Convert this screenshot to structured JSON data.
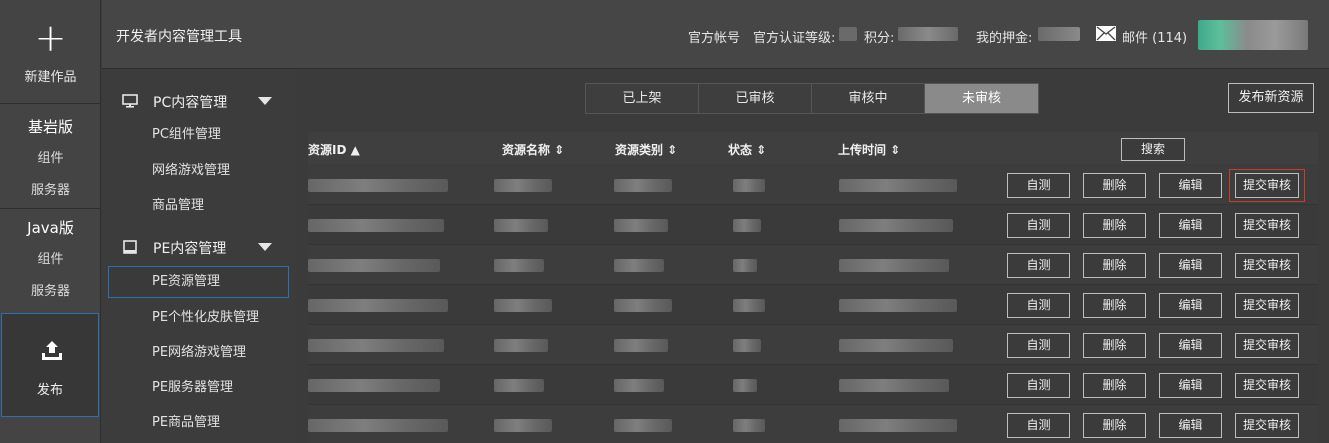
{
  "rail": {
    "new_label": "新建作品",
    "plus_icon": "plus-icon",
    "bedrock": {
      "title": "基岩版",
      "items": [
        "组件",
        "服务器"
      ]
    },
    "java": {
      "title": "Java版",
      "items": [
        "组件",
        "服务器"
      ]
    },
    "publish_label": "发布",
    "publish_icon": "upload-icon"
  },
  "topbar": {
    "title": "开发者内容管理工具",
    "official_account": "官方帐号",
    "cert_level": "官方认证等级:",
    "points": "积分:",
    "deposit": "我的押金:",
    "mail": "邮件 (114)",
    "mail_icon": "mail-icon"
  },
  "subnav": {
    "pc": {
      "title": "PC内容管理",
      "icon": "monitor-icon",
      "items": [
        "PC组件管理",
        "网络游戏管理",
        "商品管理"
      ]
    },
    "pe": {
      "title": "PE内容管理",
      "icon": "tablet-icon",
      "items": [
        "PE资源管理",
        "PE个性化皮肤管理",
        "PE网络游戏管理",
        "PE服务器管理",
        "PE商品管理"
      ]
    }
  },
  "main": {
    "tabs": [
      "已上架",
      "已审核",
      "审核中",
      "未审核"
    ],
    "selected_tab": "未审核",
    "publish_new": "发布新资源",
    "search": "搜索",
    "columns": [
      "资源ID",
      "资源名称",
      "资源类别",
      "状态",
      "上传时间"
    ],
    "row_actions": {
      "test": "自测",
      "delete": "删除",
      "edit": "编辑",
      "submit": "提交审核"
    },
    "row_count": 7
  },
  "colors": {
    "accent_border": "#2f6fb0",
    "highlight_red": "#cf3b2a",
    "tab_selected": "#8a8a8a"
  }
}
